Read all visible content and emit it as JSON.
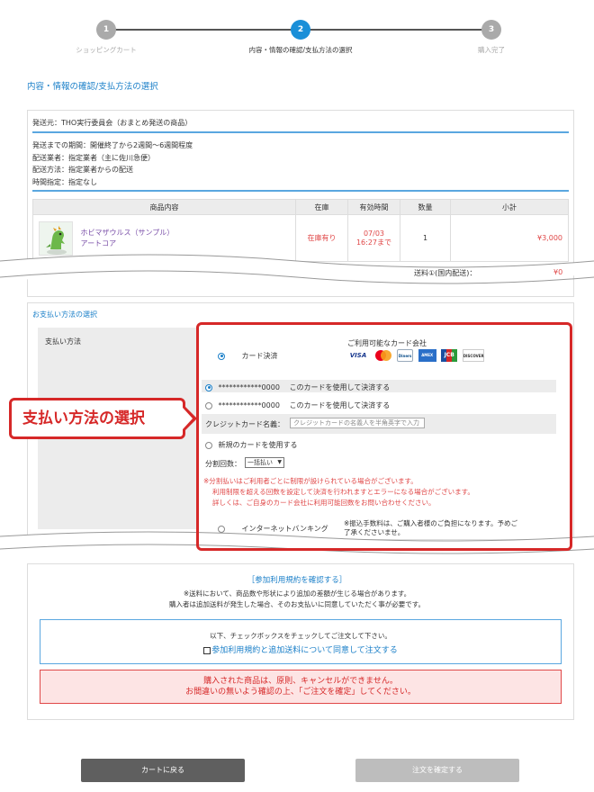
{
  "stepper": {
    "steps": [
      {
        "num": "1",
        "label": "ショッピングカート"
      },
      {
        "num": "2",
        "label": "内容・情報の確認/支払方法の選択"
      },
      {
        "num": "3",
        "label": "購入完了"
      }
    ]
  },
  "page_heading": "内容・情報の確認/支払方法の選択",
  "shipment": {
    "from": "発送元：THO実行委員会（おまとめ発送の商品）",
    "lines": [
      "発送までの期間：開催終了から2週間〜6週間程度",
      "配送業者：指定業者（主に佐川急便）",
      "配送方法：指定業者からの配送",
      "時間指定：指定なし"
    ]
  },
  "items_table": {
    "headers": [
      "商品内容",
      "在庫",
      "有効時間",
      "数量",
      "小計"
    ],
    "rows": [
      {
        "name_line1": "ホビマザウルス（サンプル）",
        "name_line2": "アートコア",
        "stock": "在庫有り",
        "valid_date": "07/03",
        "valid_time": "16:27まで",
        "qty": "1",
        "subtotal": "¥3,000"
      }
    ],
    "shipping_label": "送料①(国内配送)：",
    "shipping_value": "¥0"
  },
  "payment": {
    "section_title": "お支払い方法の選択",
    "label": "支払い方法",
    "card_option": "カード決済",
    "card_companies_label": "ご利用可能なカード会社",
    "card_logos": [
      "VISA",
      "mastercard",
      "Diners",
      "AMEX",
      "JCB",
      "DISCOVER"
    ],
    "saved_cards": [
      {
        "number": "************0000",
        "action": "このカードを使用して決済する"
      },
      {
        "number": "************0000",
        "action": "このカードを使用して決済する"
      }
    ],
    "cc_name_label": "クレジットカード名義：",
    "cc_name_placeholder": "クレジットカードの名義人を半角英字で入力",
    "new_card_label": "新規のカードを使用する",
    "installments_label": "分割回数：",
    "installments_value": "一括払い",
    "installment_warnings": [
      "※分割払いはご利用者ごとに制限が設けられている場合がございます。",
      "利用制限を超える回数を設定して決済を行われますとエラーになる場合がございます。",
      "詳しくは、ご自身のカード会社に利用可能回数をお問い合わせください。"
    ],
    "netbank_label": "インターネットバンキング",
    "netbank_note_1": "※振込手数料は、ご購入者様のご負担になります。予めご",
    "netbank_note_2": "了承くださいませ。"
  },
  "callout": "支払い方法の選択",
  "terms": {
    "link": "［参加利用規約を確認する］",
    "note_1": "※送料において、商品数や形状により追加の差額が生じる場合があります。",
    "note_2": "購入者は追加送料が発生した場合、そのお支払いに同意していただく事が必要です。",
    "agree_instruction": "以下、チェックボックスをチェックしてご注文して下さい。",
    "agree_checkbox": "参加利用規約と追加送料について同意して注文する",
    "warning_1": "購入された商品は、原則、キャンセルができません。",
    "warning_2": "お間違いの無いよう確認の上、「ご注文を確定」してください。"
  },
  "buttons": {
    "back": "カートに戻る",
    "confirm": "注文を確定する"
  },
  "colors": {
    "accent": "#1a8fd8",
    "highlight": "#d62828",
    "price": "#e04848"
  }
}
